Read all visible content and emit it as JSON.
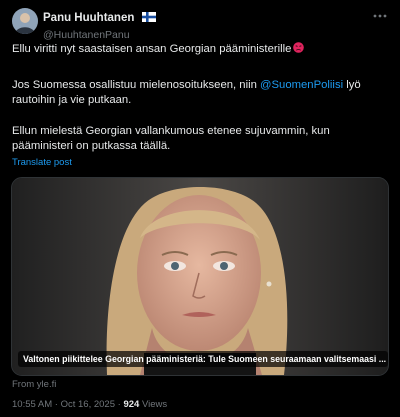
{
  "author": {
    "display_name": "Panu Huuhtanen",
    "handle": "@HuuhtanenPanu",
    "flag_icon": "finland-flag-icon"
  },
  "tweet": {
    "paragraph1": "Ellu viritti nyt saastaisen ansan Georgian pääministerille",
    "paragraph1_emoji": "angry-face-icon",
    "paragraph2_before": "Jos Suomessa osallistuu mielenosoitukseen, niin ",
    "paragraph2_mention": "@SuomenPoliisi",
    "paragraph2_after": " lyö rautoihin ja vie putkaan.",
    "paragraph3": "Ellun mielestä Georgian vallankumous etenee sujuvammin, kun pääministeri on putkassa täällä.",
    "translate_label": "Translate post"
  },
  "card": {
    "caption": "Valtonen piikittelee Georgian pääministeriä: Tule Suomeen seuraamaan valitsemaasi ...",
    "source": "From yle.fi"
  },
  "meta": {
    "time": "10:55 AM",
    "separator": " · ",
    "date": "Oct 16, 2025",
    "views_count": "924",
    "views_label": "Views"
  },
  "colors": {
    "background": "#000000",
    "text": "#e7e9ea",
    "secondary_text": "#71767b",
    "link": "#1d9bf0"
  }
}
